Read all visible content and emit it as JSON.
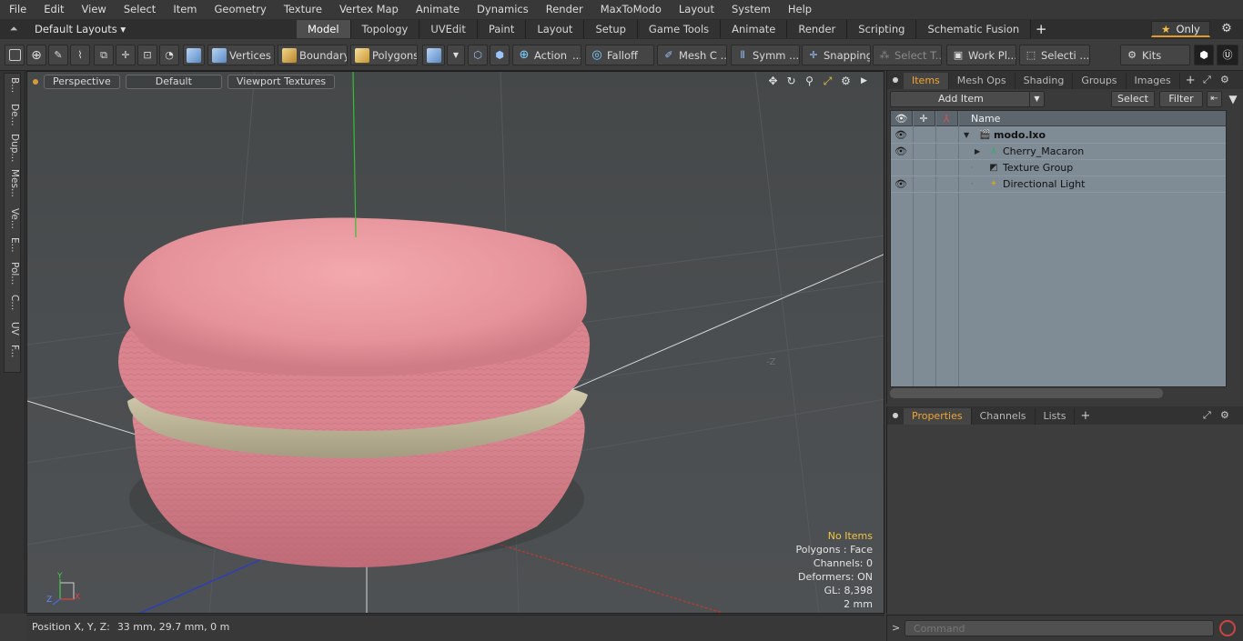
{
  "menu": [
    "File",
    "Edit",
    "View",
    "Select",
    "Item",
    "Geometry",
    "Texture",
    "Vertex Map",
    "Animate",
    "Dynamics",
    "Render",
    "MaxToModo",
    "Layout",
    "System",
    "Help"
  ],
  "layout_dropdown": "Default Layouts",
  "layout_tabs": [
    "Model",
    "Topology",
    "UVEdit",
    "Paint",
    "Layout",
    "Setup",
    "Game Tools",
    "Animate",
    "Render",
    "Scripting",
    "Schematic Fusion"
  ],
  "active_layout_tab": "Model",
  "only_label": "Only",
  "toolbar": {
    "vertices": "Vertices",
    "boundary": "Boundary",
    "polygons": "Polygons",
    "action": "Action",
    "action_more": "...",
    "falloff": "Falloff",
    "mesh": "Mesh C ...",
    "symm": "Symm ...",
    "snapping": "Snapping",
    "select_t": "Select T...",
    "work_pl": "Work Pl...",
    "selecti": "Selecti ...",
    "kits": "Kits"
  },
  "left_tabs": [
    "B...",
    "De...",
    "Dup...",
    "Mes...",
    "Ve...",
    "E...",
    "Pol...",
    "C...",
    "UV",
    "F..."
  ],
  "viewport": {
    "view_mode": "Perspective",
    "shading": "Default",
    "texture_mode": "Viewport Textures",
    "z_axis_label": "-Z",
    "stats": {
      "selection": "No Items",
      "polygons": "Polygons : Face",
      "channels": "Channels: 0",
      "deformers": "Deformers: ON",
      "gl": "GL: 8,398",
      "units": "2 mm"
    },
    "axis_labels": {
      "y": "Y",
      "x": "X",
      "z": "Z"
    }
  },
  "status": {
    "label": "Position X, Y, Z:",
    "value": "33 mm, 29.7 mm, 0 m"
  },
  "items_panel": {
    "tabs": [
      "Items",
      "Mesh Ops",
      "Shading",
      "Groups",
      "Images"
    ],
    "active_tab": "Items",
    "add_item": "Add Item",
    "select": "Select",
    "filter": "Filter",
    "name_header": "Name",
    "tree": [
      {
        "name": "modo.lxo",
        "level": 0,
        "icon": "scene-icon",
        "bold": true
      },
      {
        "name": "Cherry_Macaron",
        "level": 1,
        "icon": "mesh-icon",
        "bold": false
      },
      {
        "name": "Texture Group",
        "level": 1,
        "icon": "texture-icon",
        "bold": false
      },
      {
        "name": "Directional Light",
        "level": 1,
        "icon": "light-icon",
        "bold": false
      }
    ]
  },
  "properties_panel": {
    "tabs": [
      "Properties",
      "Channels",
      "Lists"
    ],
    "active_tab": "Properties"
  },
  "command": {
    "placeholder": "Command"
  },
  "colors": {
    "accent": "#f2a532",
    "macaron_shell": "#e89aa0",
    "macaron_filling": "#c9c2a6",
    "tree_bg": "#7f8c96"
  }
}
